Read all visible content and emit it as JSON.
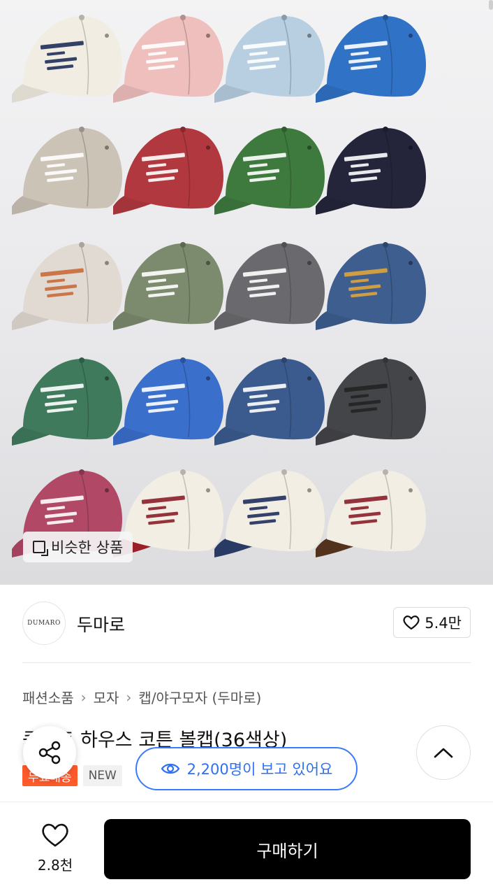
{
  "product_image": {
    "caps": [
      {
        "crown": "#f1ede2",
        "brim": "#f1ede2",
        "text": "#1f2d5a"
      },
      {
        "crown": "#eebfbd",
        "brim": "#eebfbd",
        "text": "#ffffff"
      },
      {
        "crown": "#b7cfe0",
        "brim": "#b7cfe0",
        "text": "#ffffff"
      },
      {
        "crown": "#2f72c6",
        "brim": "#2f72c6",
        "text": "#ffffff"
      },
      {
        "crown": "#cbc3b6",
        "brim": "#cbc3b6",
        "text": "#ffffff"
      },
      {
        "crown": "#b1383e",
        "brim": "#b1383e",
        "text": "#ffffff"
      },
      {
        "crown": "#3e7a3e",
        "brim": "#3e7a3e",
        "text": "#ffffff"
      },
      {
        "crown": "#24253a",
        "brim": "#24253a",
        "text": "#ffffff"
      },
      {
        "crown": "#e1dad2",
        "brim": "#e1dad2",
        "text": "#c96a3a"
      },
      {
        "crown": "#7c8a6e",
        "brim": "#7c8a6e",
        "text": "#ffffff"
      },
      {
        "crown": "#6a6a6e",
        "brim": "#6a6a6e",
        "text": "#ffffff"
      },
      {
        "crown": "#3d5e8f",
        "brim": "#3d5e8f",
        "text": "#e0a53a"
      },
      {
        "crown": "#3f7a5c",
        "brim": "#3f7a5c",
        "text": "#ffffff"
      },
      {
        "crown": "#3a6fcc",
        "brim": "#3a6fcc",
        "text": "#ffffff"
      },
      {
        "crown": "#3b5b8e",
        "brim": "#3b5b8e",
        "text": "#ffffff"
      },
      {
        "crown": "#444549",
        "brim": "#444549",
        "text": "#222222"
      },
      {
        "crown": "#b04866",
        "brim": "#b04866",
        "text": "#ffffff"
      },
      {
        "crown": "#f2eee4",
        "brim": "#a8222c",
        "text": "#8a1e28"
      },
      {
        "crown": "#f2eee4",
        "brim": "#2d3f6e",
        "text": "#1f2d5a"
      },
      {
        "crown": "#f2eee4",
        "brim": "#5a3620",
        "text": "#8a1e28"
      }
    ],
    "similar_label": "비슷한 상품"
  },
  "brand": {
    "logo_text": "DUMARO",
    "name": "두마로",
    "likes": "5.4만"
  },
  "breadcrumb": [
    "패션소품",
    "모자",
    "캡/야구모자 (두마로)"
  ],
  "product": {
    "title": "쿤스트 하우스 코튼 볼캡(36색상)",
    "badge_sale": "무료배송",
    "badge_new": "NEW"
  },
  "viewers": {
    "text": "2,200명이 보고 있어요"
  },
  "bottom": {
    "wish_count": "2.8천",
    "buy_label": "구매하기"
  },
  "colors": {
    "accent_blue": "#3a7bfd",
    "sale_badge": "#ff5a2b",
    "buy_button": "#000000"
  }
}
